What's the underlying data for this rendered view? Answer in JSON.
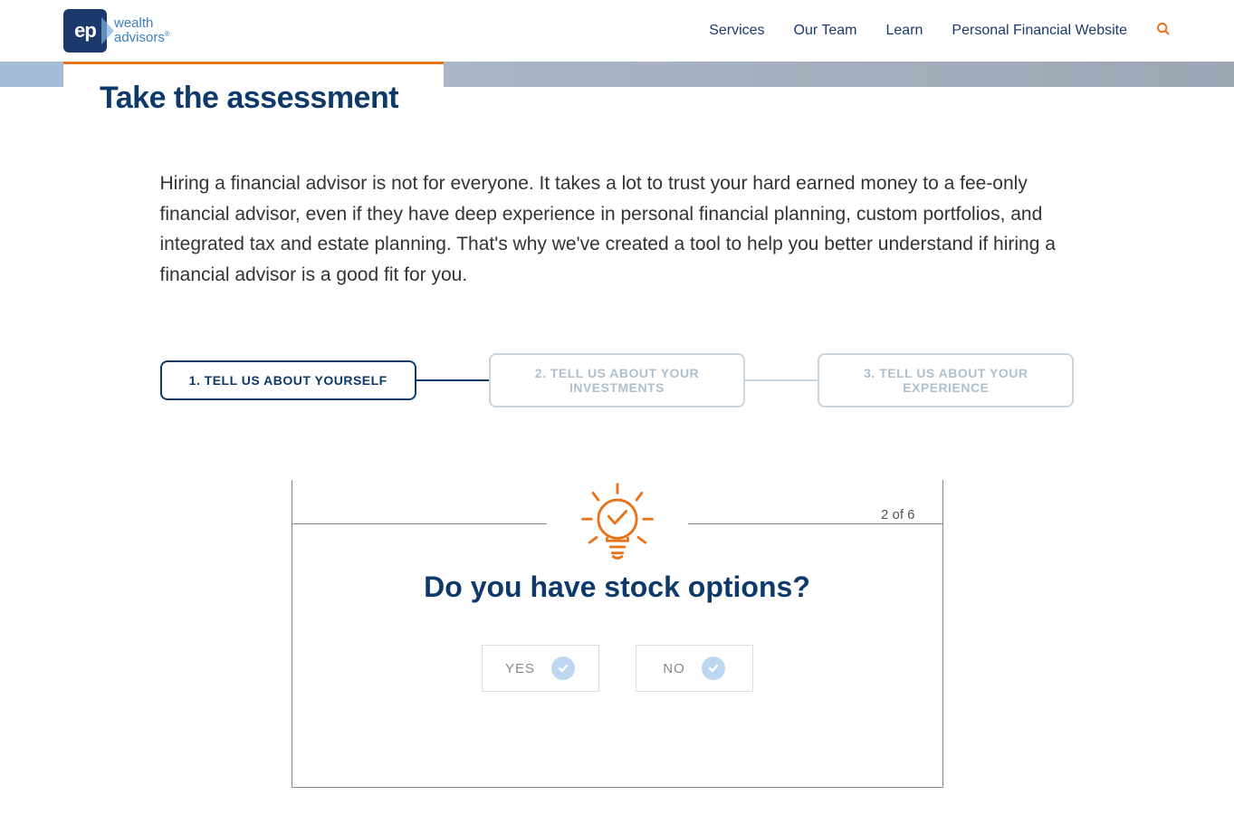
{
  "logo": {
    "initials": "ep",
    "text_line1": "wealth",
    "text_line2": "advisors"
  },
  "nav": {
    "items": [
      "Services",
      "Our Team",
      "Learn",
      "Personal Financial Website"
    ]
  },
  "page": {
    "title": "Take the assessment",
    "intro": "Hiring a financial advisor is not for everyone. It takes a lot to trust your hard earned money to a fee-only financial advisor, even if they have deep experience in personal financial planning, custom portfolios, and integrated tax and estate planning. That's why we've created a tool to help you better understand if hiring a financial advisor is a good fit for you."
  },
  "steps": [
    {
      "label": "1. TELL US ABOUT YOURSELF",
      "active": true
    },
    {
      "label": "2. TELL US ABOUT YOUR INVESTMENTS",
      "active": false
    },
    {
      "label": "3. TELL US ABOUT YOUR EXPERIENCE",
      "active": false
    }
  ],
  "assessment": {
    "progress": "2 of 6",
    "question": "Do you have stock options?",
    "options": [
      {
        "label": "YES"
      },
      {
        "label": "NO"
      }
    ]
  }
}
